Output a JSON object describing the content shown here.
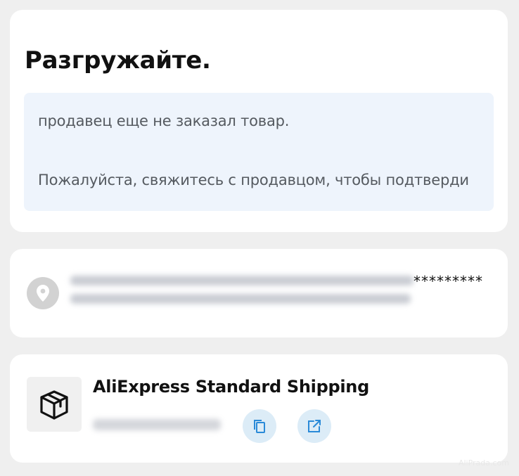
{
  "status": {
    "title": "Разгружайте.",
    "notice_line1": "продавец еще не заказал товар.",
    "notice_line2": "Пожалуйста, свяжитесь с продавцом, чтобы подтверди"
  },
  "address": {
    "icon": "location-pin-icon",
    "masked_suffix": "*********"
  },
  "shipping": {
    "icon": "package-icon",
    "carrier": "AliExpress Standard Shipping",
    "copy_icon": "copy-icon",
    "open_icon": "external-link-icon"
  },
  "watermark": "AliPrada.com",
  "colors": {
    "background": "#efefef",
    "card": "#ffffff",
    "notice_bg": "#eef4fc",
    "icon_button_bg": "#dcecf7",
    "accent": "#2a8ad8"
  }
}
